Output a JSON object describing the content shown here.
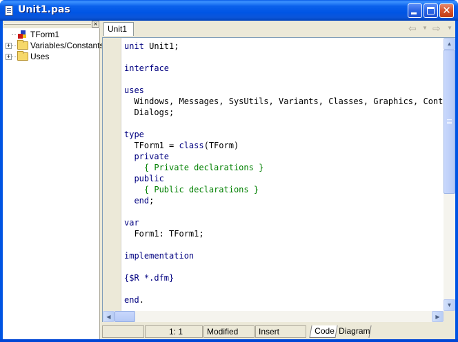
{
  "window": {
    "title": "Unit1.pas",
    "buttons": {
      "minimize": "minimize",
      "maximize": "maximize",
      "close": "close"
    }
  },
  "explorer": {
    "close_glyph": "×",
    "items": [
      {
        "label": "TForm1",
        "icon": "form-icon",
        "expandable": false
      },
      {
        "label": "Variables/Constants",
        "icon": "folder-icon",
        "expandable": true
      },
      {
        "label": "Uses",
        "icon": "folder-icon",
        "expandable": true
      }
    ],
    "expander_glyph": "+"
  },
  "tabs": [
    {
      "label": "Unit1",
      "active": true
    }
  ],
  "nav": {
    "back": "back-arrow-icon",
    "forward": "forward-arrow-icon"
  },
  "code": {
    "lines": [
      [
        {
          "t": "unit",
          "c": "kw"
        },
        {
          "t": " Unit1;",
          "c": ""
        }
      ],
      [],
      [
        {
          "t": "interface",
          "c": "kw"
        }
      ],
      [],
      [
        {
          "t": "uses",
          "c": "kw"
        }
      ],
      [
        {
          "t": "  Windows, Messages, SysUtils, Variants, Classes, Graphics, Controls, Forms,",
          "c": ""
        }
      ],
      [
        {
          "t": "  Dialogs;",
          "c": ""
        }
      ],
      [],
      [
        {
          "t": "type",
          "c": "kw"
        }
      ],
      [
        {
          "t": "  TForm1 = ",
          "c": ""
        },
        {
          "t": "class",
          "c": "kw"
        },
        {
          "t": "(TForm)",
          "c": ""
        }
      ],
      [
        {
          "t": "  ",
          "c": ""
        },
        {
          "t": "private",
          "c": "kw"
        }
      ],
      [
        {
          "t": "    { Private declarations }",
          "c": "cm"
        }
      ],
      [
        {
          "t": "  ",
          "c": ""
        },
        {
          "t": "public",
          "c": "kw"
        }
      ],
      [
        {
          "t": "    { Public declarations }",
          "c": "cm"
        }
      ],
      [
        {
          "t": "  ",
          "c": ""
        },
        {
          "t": "end",
          "c": "kw"
        },
        {
          "t": ";",
          "c": ""
        }
      ],
      [],
      [
        {
          "t": "var",
          "c": "kw"
        }
      ],
      [
        {
          "t": "  Form1: TForm1;",
          "c": ""
        }
      ],
      [],
      [
        {
          "t": "implementation",
          "c": "kw"
        }
      ],
      [],
      [
        {
          "t": "{$R *.dfm}",
          "c": "kw"
        }
      ],
      [],
      [
        {
          "t": "end",
          "c": "kw"
        },
        {
          "t": ".",
          "c": ""
        }
      ]
    ]
  },
  "status": {
    "position": "1:   1",
    "modified": "Modified",
    "mode": "Insert",
    "view_tabs": [
      "Code",
      "Diagram"
    ]
  },
  "colors": {
    "keyword": "#000080",
    "comment": "#008000",
    "title_bar": "#0055e5"
  }
}
